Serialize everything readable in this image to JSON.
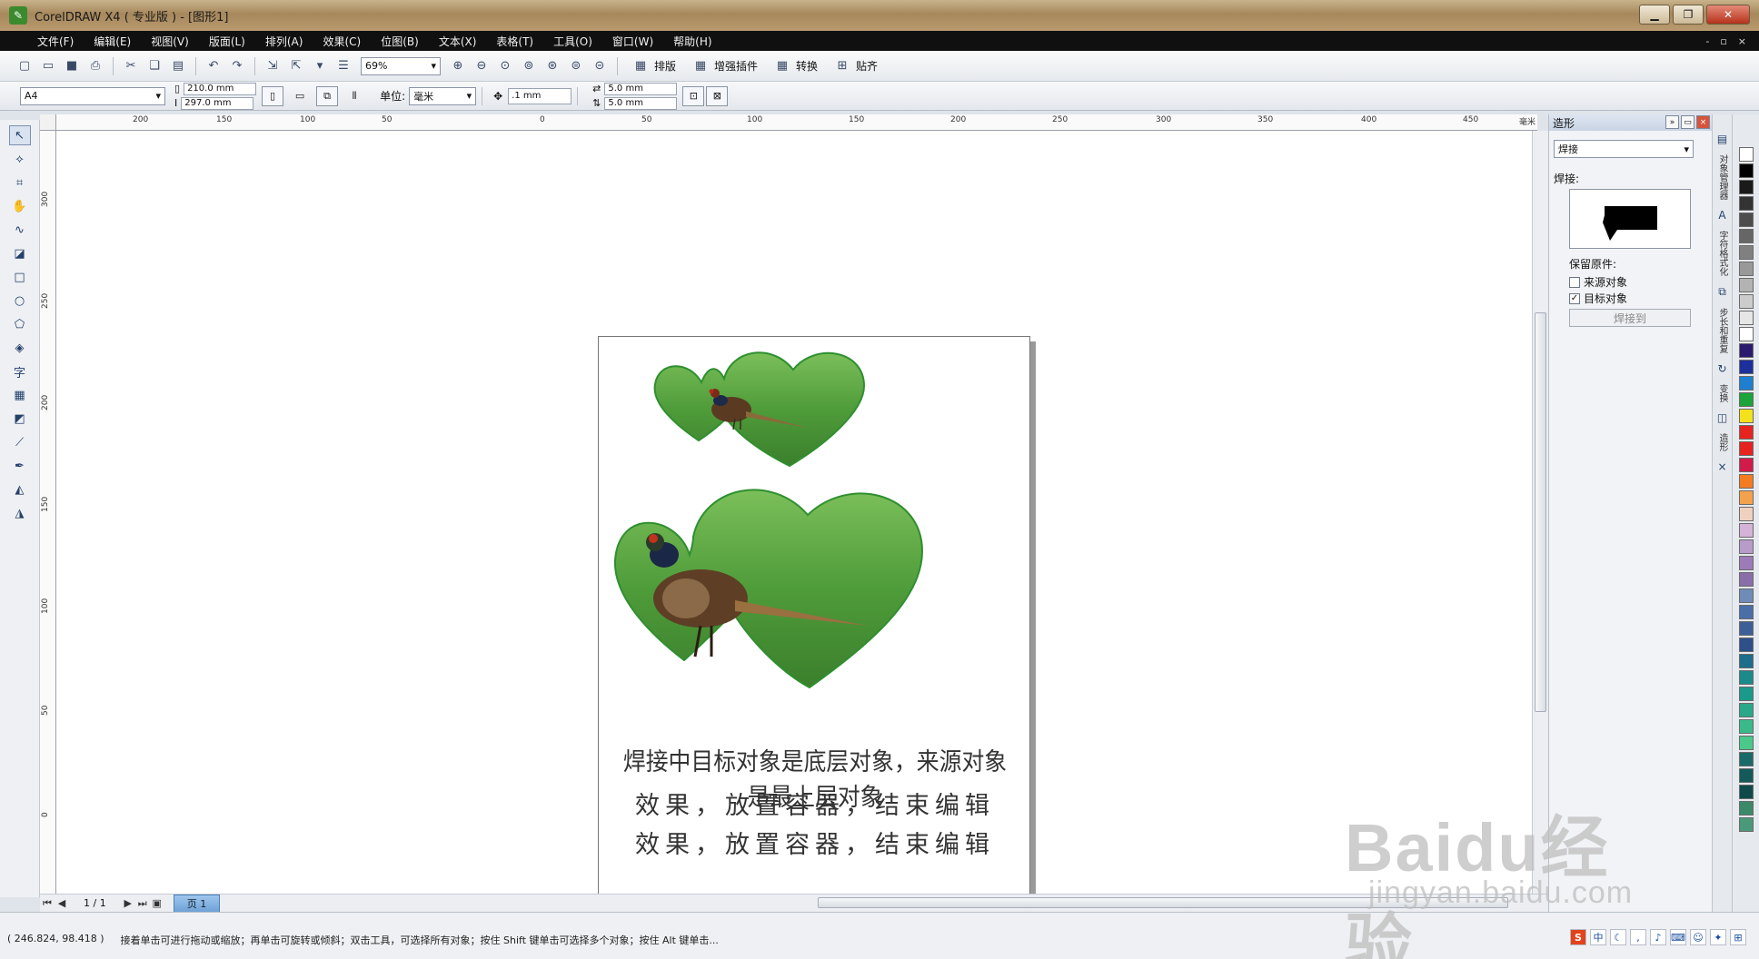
{
  "window": {
    "title": "CorelDRAW X4 ( 专业版 ) - [图形1]"
  },
  "menu": [
    "文件(F)",
    "编辑(E)",
    "视图(V)",
    "版面(L)",
    "排列(A)",
    "效果(C)",
    "位图(B)",
    "文本(X)",
    "表格(T)",
    "工具(O)",
    "窗口(W)",
    "帮助(H)"
  ],
  "toolbar": {
    "zoom": "69%",
    "arrange_label": "排版",
    "plugin_label": "增强插件",
    "convert_label": "转换",
    "snap_label": "贴齐"
  },
  "property_bar": {
    "paper": "A4",
    "width": "210.0 mm",
    "height": "297.0 mm",
    "units_label": "单位:",
    "units_value": "毫米",
    "nudge": ".1 mm",
    "dup_x": "5.0 mm",
    "dup_y": "5.0 mm"
  },
  "ruler": {
    "h_labels": [
      "200",
      "150",
      "100",
      "50",
      "0",
      "50",
      "100",
      "150",
      "200",
      "250",
      "300",
      "350",
      "400",
      "450"
    ],
    "v_labels": [
      "300",
      "250",
      "200",
      "150",
      "100",
      "50",
      "0"
    ],
    "unit": "毫米"
  },
  "page": {
    "line1": "焊接中目标对象是底层对象，来源对象是最上层对象",
    "line2": "效果，放置容器，结束编辑",
    "line3": "效果，放置容器，结束编辑"
  },
  "page_nav": {
    "count": "1 / 1",
    "tab": "页 1"
  },
  "docker": {
    "title": "造形",
    "mode": "焊接",
    "weld_label": "焊接:",
    "keep_label": "保留原件:",
    "source_label": "来源对象",
    "target_label": "目标对象",
    "source_checked": false,
    "target_checked": true,
    "weld_button": "焊接到",
    "tabs": [
      "对象管理器",
      "字符格式化",
      "步长和重复",
      "变换",
      "造形"
    ]
  },
  "palette": [
    "#ffffff",
    "#000000",
    "#1a1a1a",
    "#333333",
    "#4d4d4d",
    "#666666",
    "#808080",
    "#999999",
    "#b3b3b3",
    "#cccccc",
    "#e6e6e6",
    "#ffffff",
    "#2b1b6e",
    "#1c2f9c",
    "#1e7fd0",
    "#1aa43a",
    "#f3e11c",
    "#e7231f",
    "#e7231f",
    "#d21b4a",
    "#f47b20",
    "#f2a24c",
    "#efd1c0",
    "#d5b3d8",
    "#b79bc8",
    "#9c7bb8",
    "#8a6eaa",
    "#6f8bb8",
    "#4a6fa8",
    "#3d5f98",
    "#2e4f8a",
    "#1d6e8a",
    "#1a8a8a",
    "#1a9a8a",
    "#2aa98a",
    "#3ab98a",
    "#4ac98a",
    "#1a6a6a",
    "#155a5a",
    "#0f4a4a",
    "#3a8a6a",
    "#4a9a7a"
  ],
  "status": {
    "coords": "( 246.824, 98.418 )",
    "hint": "接着单击可进行拖动或缩放；再单击可旋转或倾斜；双击工具，可选择所有对象；按住 Shift 键单击可选择多个对象；按住 Alt 键单击..."
  },
  "watermark": {
    "main": "Baidu经验",
    "sub": "jingyan.baidu.com"
  }
}
